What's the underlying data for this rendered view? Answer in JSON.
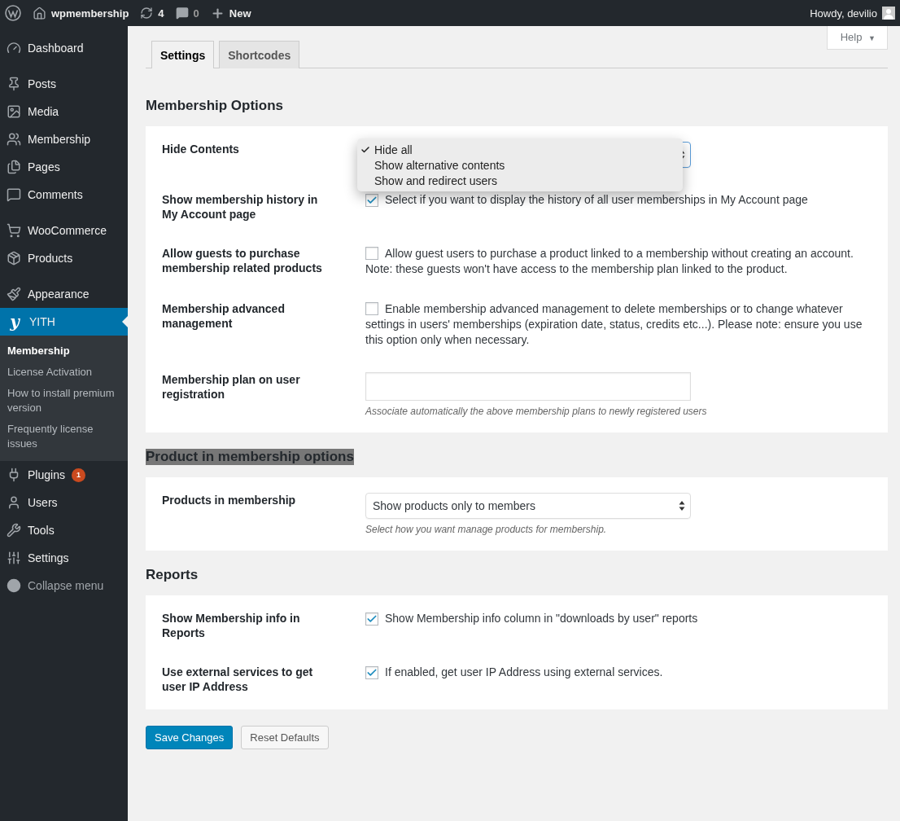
{
  "admin_bar": {
    "site_name": "wpmembership",
    "updates": "4",
    "comments": "0",
    "new": "New",
    "greeting": "Howdy, devilio"
  },
  "sidebar": {
    "groups": [
      [
        {
          "label": "Dashboard",
          "selected": false
        }
      ],
      [
        {
          "label": "Posts",
          "selected": false
        },
        {
          "label": "Media",
          "selected": false
        },
        {
          "label": "Membership",
          "selected": false
        },
        {
          "label": "Pages",
          "selected": false
        },
        {
          "label": "Comments",
          "selected": false
        }
      ],
      [
        {
          "label": "WooCommerce",
          "selected": false
        },
        {
          "label": "Products",
          "selected": false
        }
      ],
      [
        {
          "label": "Appearance",
          "selected": false
        },
        {
          "label": "YITH",
          "logo_letter": "y",
          "selected": true,
          "children": [
            {
              "label": "Membership",
              "selected": true
            },
            {
              "label": "License Activation",
              "selected": false
            },
            {
              "label": "How to install premium version",
              "selected": false
            },
            {
              "label": "Frequently license issues",
              "selected": false
            }
          ]
        },
        {
          "label": "Plugins",
          "badge": "1",
          "selected": false
        },
        {
          "label": "Users",
          "selected": false
        },
        {
          "label": "Tools",
          "selected": false
        },
        {
          "label": "Settings",
          "selected": false
        },
        {
          "label": "Collapse menu",
          "kind": "collapse",
          "selected": false
        }
      ]
    ]
  },
  "help_button": {
    "label": "Help",
    "arrow": "▼"
  },
  "tabs": [
    {
      "label": "Settings",
      "selected": true
    },
    {
      "label": "Shortcodes",
      "selected": false
    }
  ],
  "sections": [
    {
      "title": "Membership Options",
      "highlighted": false,
      "rows": [
        {
          "label": "Hide Contents",
          "kind": "select",
          "open": true,
          "options": [
            {
              "label": "Hide all",
              "selected": true
            },
            {
              "label": "Show alternative contents",
              "selected": false
            },
            {
              "label": "Show and redirect users",
              "selected": false
            }
          ]
        },
        {
          "label": "Show membership history in My Account page",
          "kind": "checkbox",
          "checked": true,
          "text": "Select if you want to display the history of all user memberships in My Account page"
        },
        {
          "label": "Allow guests to purchase membership related products",
          "kind": "checkbox",
          "checked": false,
          "text": "Allow guest users to purchase a product linked to a membership without creating an account. Note: these guests won't have access to the membership plan linked to the product."
        },
        {
          "label": "Membership advanced management",
          "kind": "checkbox",
          "checked": false,
          "text": "Enable membership advanced management to delete memberships or to change whatever settings in users' memberships (expiration date, status, credits etc...). Please note: ensure you use this option only when necessary."
        },
        {
          "label": "Membership plan on user registration",
          "kind": "text",
          "description": "Associate automatically the above membership plans to newly registered users"
        }
      ]
    },
    {
      "title": "Product in membership options",
      "highlighted": true,
      "rows": [
        {
          "label": "Products in membership",
          "kind": "select",
          "open": false,
          "value": "Show products only to members",
          "description": "Select how you want manage products for membership."
        }
      ]
    },
    {
      "title": "Reports",
      "highlighted": false,
      "rows": [
        {
          "label": "Show Membership info in Reports",
          "kind": "checkbox",
          "checked": true,
          "text": "Show Membership info column in \"downloads by user\" reports"
        },
        {
          "label": "Use external services to get user IP Address",
          "kind": "checkbox",
          "checked": true,
          "text": "If enabled, get user IP Address using external services."
        }
      ]
    }
  ],
  "buttons": [
    {
      "label": "Save Changes",
      "kind": "primary"
    },
    {
      "label": "Reset Defaults",
      "kind": "secondary"
    }
  ]
}
